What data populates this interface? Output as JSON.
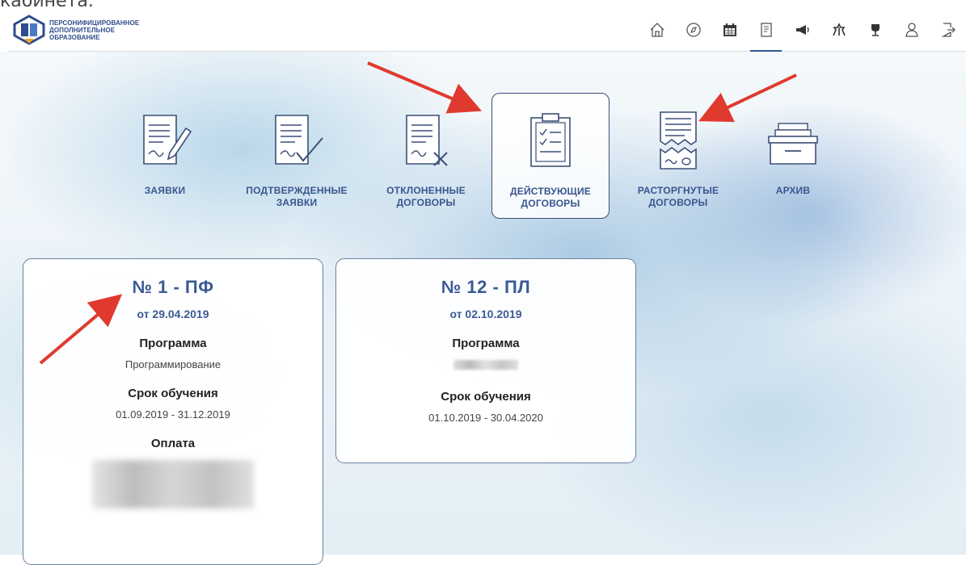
{
  "top_cut_text": "кабинета.",
  "logo": {
    "line1": "ПЕРСОНИФИЦИРОВАННОЕ",
    "line2": "ДОПОЛНИТЕЛЬНОЕ",
    "line3": "ОБРАЗОВАНИЕ"
  },
  "nav": [
    "home-icon",
    "compass-icon",
    "calendar-icon",
    "document-icon",
    "megaphone-icon",
    "horse-icon",
    "trophy-icon",
    "user-icon",
    "logout-icon"
  ],
  "nav_active": "document-icon",
  "categories": [
    {
      "label": "ЗАЯВКИ",
      "icon": "application-icon"
    },
    {
      "label": "ПОДТВЕРЖДЕННЫЕ ЗАЯВКИ",
      "icon": "confirmed-application-icon"
    },
    {
      "label": "ОТКЛОНЕННЫЕ ДОГОВОРЫ",
      "icon": "rejected-contract-icon"
    },
    {
      "label": "ДЕЙСТВУЮЩИЕ ДОГОВОРЫ",
      "icon": "clipboard-icon"
    },
    {
      "label": "РАСТОРГНУТЫЕ ДОГОВОРЫ",
      "icon": "torn-contract-icon"
    },
    {
      "label": "АРХИВ",
      "icon": "archive-icon"
    }
  ],
  "active_category": "ДЕЙСТВУЮЩИЕ ДОГОВОРЫ",
  "contracts": [
    {
      "number": "№ 1 - ПФ",
      "date": "от 29.04.2019",
      "program_label": "Программа",
      "program_value": "Программирование",
      "period_label": "Срок обучения",
      "period_value": "01.09.2019 - 31.12.2019",
      "payment_label": "Оплата"
    },
    {
      "number": "№ 12 - ПЛ",
      "date": "от 02.10.2019",
      "program_label": "Программа",
      "period_label": "Срок обучения",
      "period_value": "01.10.2019 - 30.04.2020"
    }
  ],
  "colors": {
    "accent": "#3b5a93",
    "arrow": "#e03a2f",
    "card_border": "#6b7fa3"
  }
}
